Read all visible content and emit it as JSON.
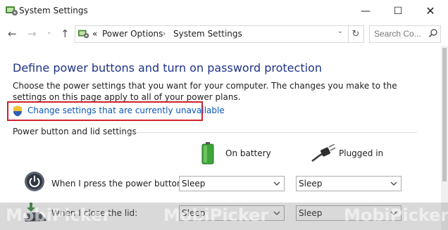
{
  "window": {
    "title": "System Settings",
    "controls": {
      "minimize": "—",
      "maximize": "☐",
      "close": "✕"
    }
  },
  "address_bar": {
    "back_glyph": "←",
    "forward_glyph": "→",
    "recent_glyph": "⌄",
    "up_glyph": "↑",
    "overflow": "«",
    "breadcrumb": [
      "Power Options",
      "System Settings"
    ],
    "separator": "›",
    "dropdown_glyph": "⌄",
    "refresh_glyph": "↻",
    "search_placeholder": "Search Co..."
  },
  "content": {
    "heading": "Define power buttons and turn on password protection",
    "description": "Choose the power settings that you want for your computer. The changes you make to the settings on this page apply to all of your power plans.",
    "change_link": "Change settings that are currently unavailable",
    "section_title": "Power button and lid settings",
    "columns": {
      "battery": "On battery",
      "plugged": "Plugged in"
    },
    "rows": [
      {
        "label": "When I press the power button:",
        "battery": "Sleep",
        "plugged": "Sleep"
      },
      {
        "label": "When I close the lid:",
        "battery": "Sleep",
        "plugged": "Sleep"
      }
    ]
  },
  "watermark": [
    "MobiPicker",
    "MobiPicker",
    "MobiPicker"
  ],
  "colors": {
    "heading": "#1e3287",
    "link": "#0a56b8",
    "highlight_box": "#d0222b"
  },
  "icons": {
    "app": "control-panel-icon",
    "shield": "uac-shield-icon",
    "battery": "battery-icon",
    "plug": "power-plug-icon",
    "power": "power-button-icon",
    "lid": "laptop-lid-icon",
    "search": "search-icon"
  }
}
